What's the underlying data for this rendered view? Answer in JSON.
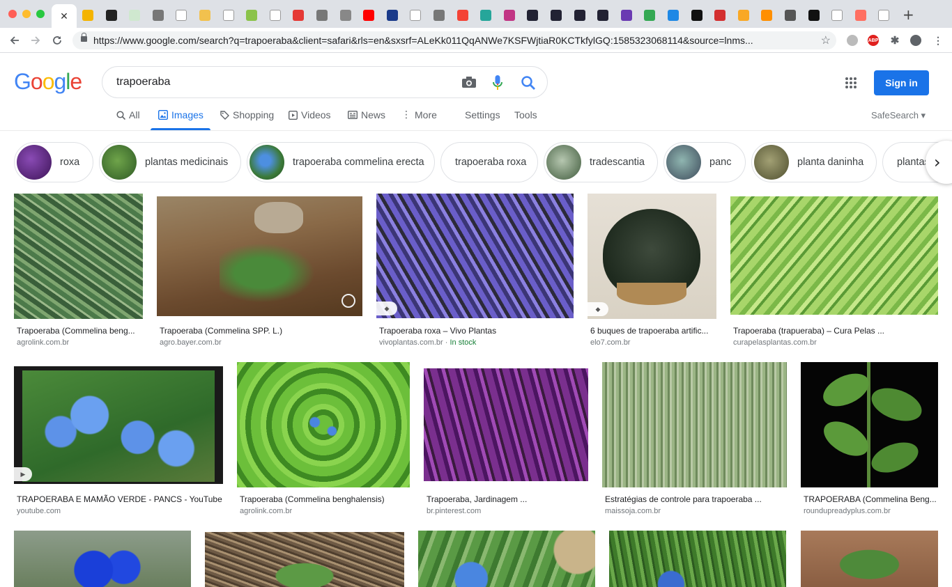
{
  "browser": {
    "active_tab_close": "✕",
    "tab_count": 36,
    "url": "https://www.google.com/search?q=trapoeraba&client=safari&rls=en&sxsrf=ALeKk011QqANWe7KSFWjtiaR0KCTkfylGQ:1585323068114&source=lnms...",
    "new_tab": "+",
    "extension_abp": "ABP"
  },
  "search": {
    "logo": [
      "G",
      "o",
      "o",
      "g",
      "l",
      "e"
    ],
    "logo_colors": [
      "#4285f4",
      "#ea4335",
      "#fbbc05",
      "#4285f4",
      "#34a853",
      "#ea4335"
    ],
    "query": "trapoeraba",
    "sign_in": "Sign in",
    "tabs": [
      "All",
      "Images",
      "Shopping",
      "Videos",
      "News",
      "More"
    ],
    "settings": "Settings",
    "tools": "Tools",
    "safesearch": "SafeSearch ▾"
  },
  "chips": [
    "roxa",
    "plantas medicinais",
    "trapoeraba commelina erecta",
    "trapoeraba roxa",
    "tradescantia",
    "panc",
    "planta daninha",
    "plantas"
  ],
  "results": [
    {
      "title": "Trapoeraba (Commelina beng...",
      "site": "agrolink.com.br"
    },
    {
      "title": "Trapoeraba (Commelina SPP. L.)",
      "site": "agro.bayer.com.br"
    },
    {
      "title": "Trapoeraba roxa – Vivo Plantas",
      "site": "vivoplantas.com.br",
      "stock": "In stock"
    },
    {
      "title": "6 buques de trapoeraba artific...",
      "site": "elo7.com.br"
    },
    {
      "title": "Trapoeraba (trapueraba) – Cura Pelas ...",
      "site": "curapelasplantas.com.br"
    },
    {
      "title": "TRAPOERABA E MAMÃO VERDE - PANCS - YouTube",
      "site": "youtube.com"
    },
    {
      "title": "Trapoeraba (Commelina benghalensis)",
      "site": "agrolink.com.br"
    },
    {
      "title": "Trapoeraba, Jardinagem ...",
      "site": "br.pinterest.com"
    },
    {
      "title": "Estratégias de controle para trapoeraba ...",
      "site": "maissoja.com.br"
    },
    {
      "title": "TRAPOERABA (Commelina Beng...",
      "site": "roundupreadyplus.com.br"
    },
    {
      "title": "",
      "site": ""
    },
    {
      "title": "",
      "site": ""
    },
    {
      "title": "",
      "site": ""
    },
    {
      "title": "",
      "site": ""
    },
    {
      "title": "",
      "site": ""
    }
  ]
}
